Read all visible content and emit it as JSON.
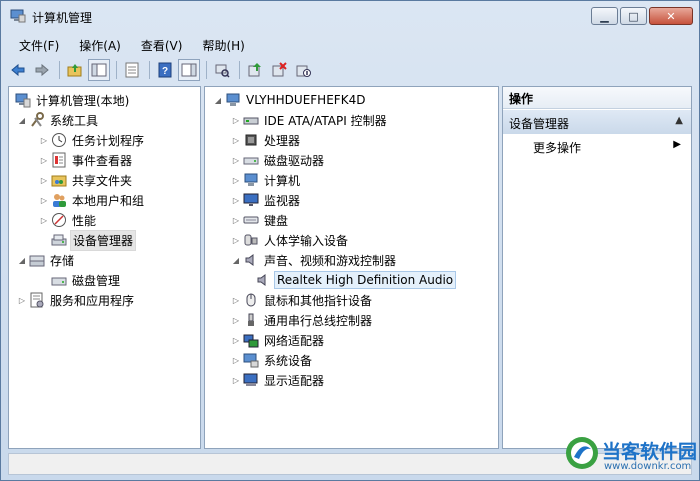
{
  "window": {
    "title": "计算机管理"
  },
  "menubar": [
    {
      "label": "文件(F)"
    },
    {
      "label": "操作(A)"
    },
    {
      "label": "查看(V)"
    },
    {
      "label": "帮助(H)"
    }
  ],
  "left_tree": {
    "root": "计算机管理(本地)",
    "system_tools": "系统工具",
    "task_scheduler": "任务计划程序",
    "event_viewer": "事件查看器",
    "shared_folders": "共享文件夹",
    "local_users": "本地用户和组",
    "performance": "性能",
    "device_manager": "设备管理器",
    "storage": "存储",
    "disk_management": "磁盘管理",
    "services_apps": "服务和应用程序"
  },
  "device_tree": {
    "computer_name": "VLYHHDUEFHEFK4D",
    "items": [
      {
        "label": "IDE ATA/ATAPI 控制器"
      },
      {
        "label": "处理器"
      },
      {
        "label": "磁盘驱动器"
      },
      {
        "label": "计算机"
      },
      {
        "label": "监视器"
      },
      {
        "label": "键盘"
      },
      {
        "label": "人体学输入设备"
      },
      {
        "label": "声音、视频和游戏控制器"
      },
      {
        "label": "Realtek High Definition Audio"
      },
      {
        "label": "鼠标和其他指针设备"
      },
      {
        "label": "通用串行总线控制器"
      },
      {
        "label": "网络适配器"
      },
      {
        "label": "系统设备"
      },
      {
        "label": "显示适配器"
      }
    ]
  },
  "actions": {
    "header": "操作",
    "group": "设备管理器",
    "more": "更多操作"
  },
  "watermark": {
    "text": "当客软件园",
    "url": "www.downkr.com"
  }
}
